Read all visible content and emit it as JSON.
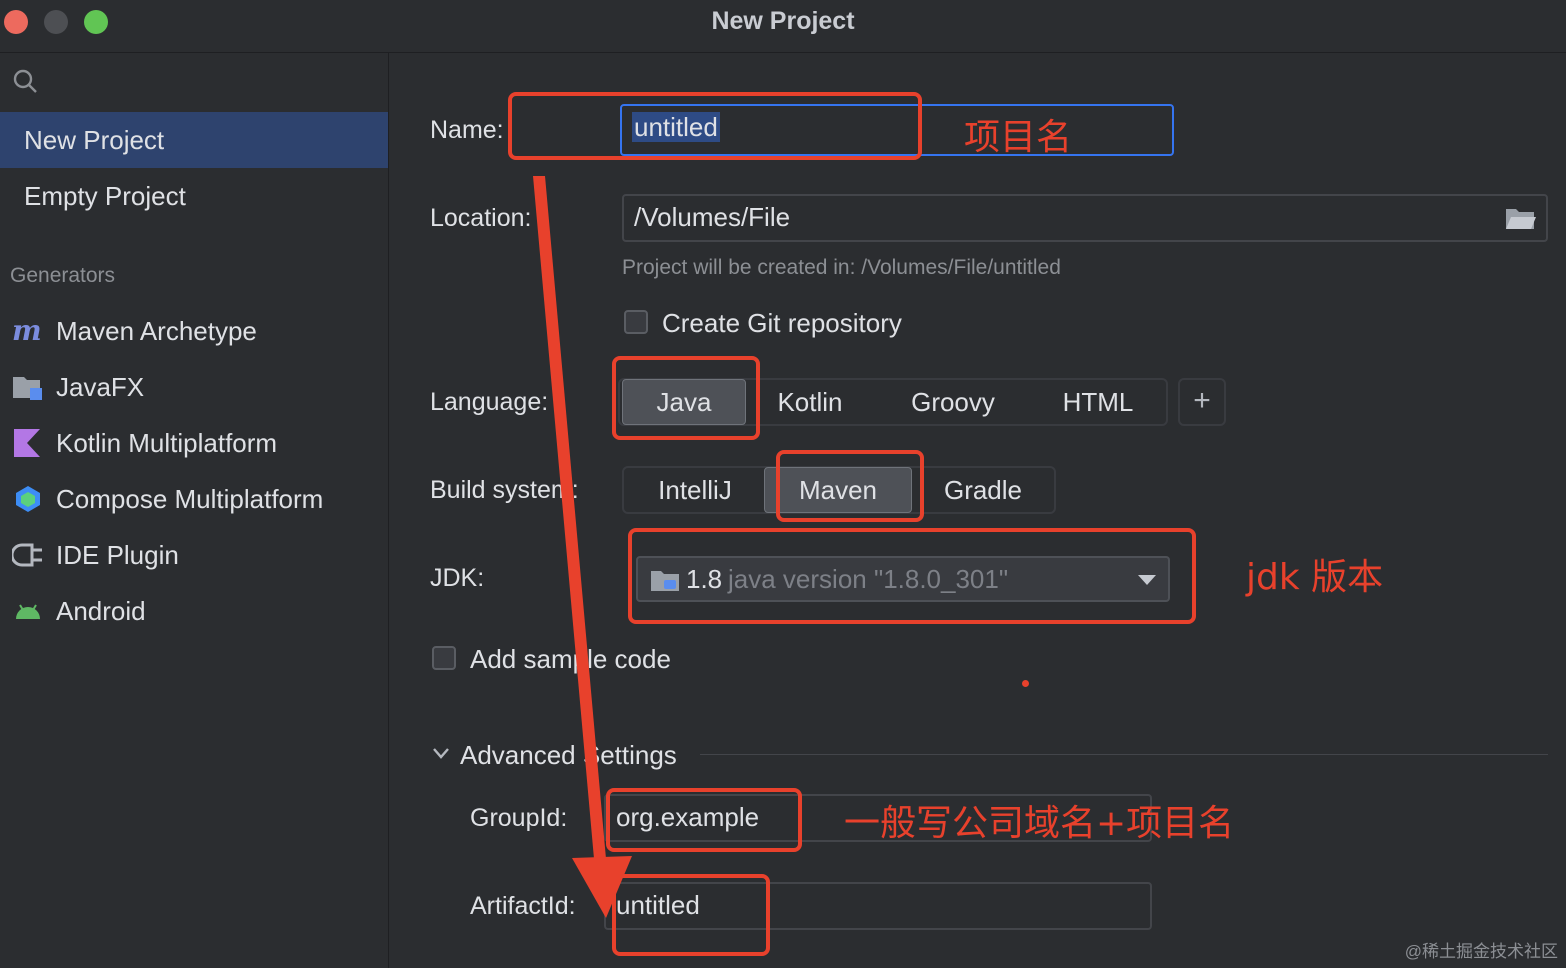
{
  "window": {
    "title": "New Project"
  },
  "sidebar": {
    "top_items": [
      {
        "label": "New Project",
        "selected": true
      },
      {
        "label": "Empty Project",
        "selected": false
      }
    ],
    "generators_label": "Generators",
    "generators": [
      {
        "label": "Maven Archetype",
        "icon": "maven-icon"
      },
      {
        "label": "JavaFX",
        "icon": "javafx-icon"
      },
      {
        "label": "Kotlin Multiplatform",
        "icon": "kotlin-icon"
      },
      {
        "label": "Compose Multiplatform",
        "icon": "compose-icon"
      },
      {
        "label": "IDE Plugin",
        "icon": "plugin-icon"
      },
      {
        "label": "Android",
        "icon": "android-icon"
      }
    ]
  },
  "form": {
    "name_label": "Name:",
    "name_value": "untitled",
    "location_label": "Location:",
    "location_value": "/Volumes/File",
    "location_hint": "Project will be created in: /Volumes/File/untitled",
    "git_label": "Create Git repository",
    "language_label": "Language:",
    "languages": [
      "Java",
      "Kotlin",
      "Groovy",
      "HTML"
    ],
    "language_selected": "Java",
    "add_language": "+",
    "build_label": "Build system:",
    "build_systems": [
      "IntelliJ",
      "Maven",
      "Gradle"
    ],
    "build_selected": "Maven",
    "jdk_label": "JDK:",
    "jdk_version": "1.8",
    "jdk_detail": "java version \"1.8.0_301\"",
    "sample_label": "Add sample code",
    "advanced_label": "Advanced Settings",
    "groupid_label": "GroupId:",
    "groupid_value": "org.example",
    "artifactid_label": "ArtifactId:",
    "artifactid_value": "untitled"
  },
  "annotations": {
    "name_note": "项目名",
    "jdk_note": "jdk 版本",
    "group_note": "一般写公司域名+项目名",
    "color": "#e8412c"
  },
  "watermark": "@稀土掘金技术社区"
}
